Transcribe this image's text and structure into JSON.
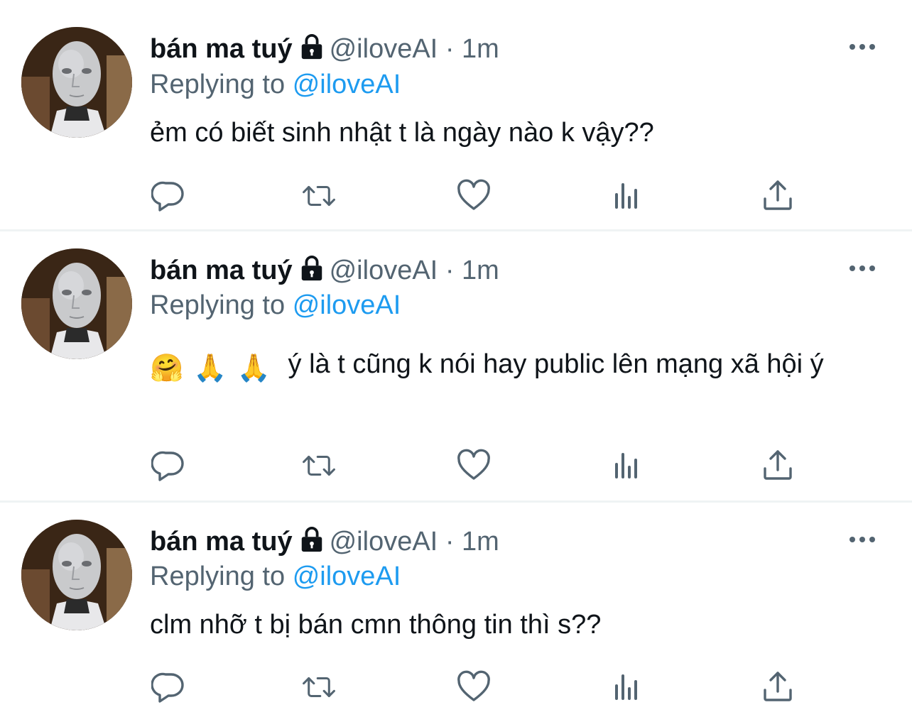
{
  "tweets": [
    {
      "display_name": "bán ma tuý",
      "handle": "@iloveAI",
      "separator": "·",
      "time": "1m",
      "replying_prefix": "Replying to",
      "replying_to": "@iloveAI",
      "text": "ẻm có biết sinh nhật t là ngày nào k vậy??"
    },
    {
      "display_name": "bán ma tuý",
      "handle": "@iloveAI",
      "separator": "·",
      "time": "1m",
      "replying_prefix": "Replying to",
      "replying_to": "@iloveAI",
      "emojis": [
        "🤗",
        "🙏",
        "🙏"
      ],
      "text": "ý là t cũng k nói hay public lên mạng xã hội ý"
    },
    {
      "display_name": "bán ma tuý",
      "handle": "@iloveAI",
      "separator": "·",
      "time": "1m",
      "replying_prefix": "Replying to",
      "replying_to": "@iloveAI",
      "text": "clm nhỡ t bị bán cmn thông tin thì s??"
    }
  ],
  "colors": {
    "text": "#0f1419",
    "secondary": "#536471",
    "link": "#1d9bf0",
    "divider": "#eff3f4"
  },
  "icons": [
    "lock-icon",
    "more-icon",
    "reply-icon",
    "retweet-icon",
    "like-icon",
    "views-icon",
    "share-icon"
  ]
}
